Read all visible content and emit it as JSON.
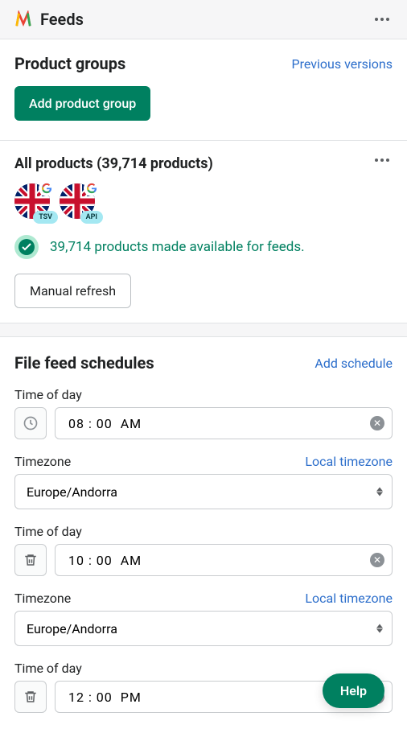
{
  "header": {
    "title": "Feeds"
  },
  "pg": {
    "title": "Product groups",
    "previous_link": "Previous versions",
    "add_button": "Add product group"
  },
  "all": {
    "title": "All products (39,714 products)",
    "flags": [
      {
        "label": "TSV"
      },
      {
        "label": "API"
      }
    ],
    "status_text": "39,714 products made available for feeds.",
    "manual_refresh": "Manual refresh"
  },
  "sched": {
    "title": "File feed schedules",
    "add_link": "Add schedule",
    "time_label": "Time of day",
    "tz_label": "Timezone",
    "local_tz_link": "Local timezone",
    "items": [
      {
        "time": "08 : 00  AM",
        "tz": "Europe/Andorra",
        "lead_icon": "clock"
      },
      {
        "time": "10 : 00  AM",
        "tz": "Europe/Andorra",
        "lead_icon": "trash"
      },
      {
        "time": "12 : 00  PM",
        "lead_icon": "trash"
      }
    ]
  },
  "help": {
    "label": "Help"
  }
}
